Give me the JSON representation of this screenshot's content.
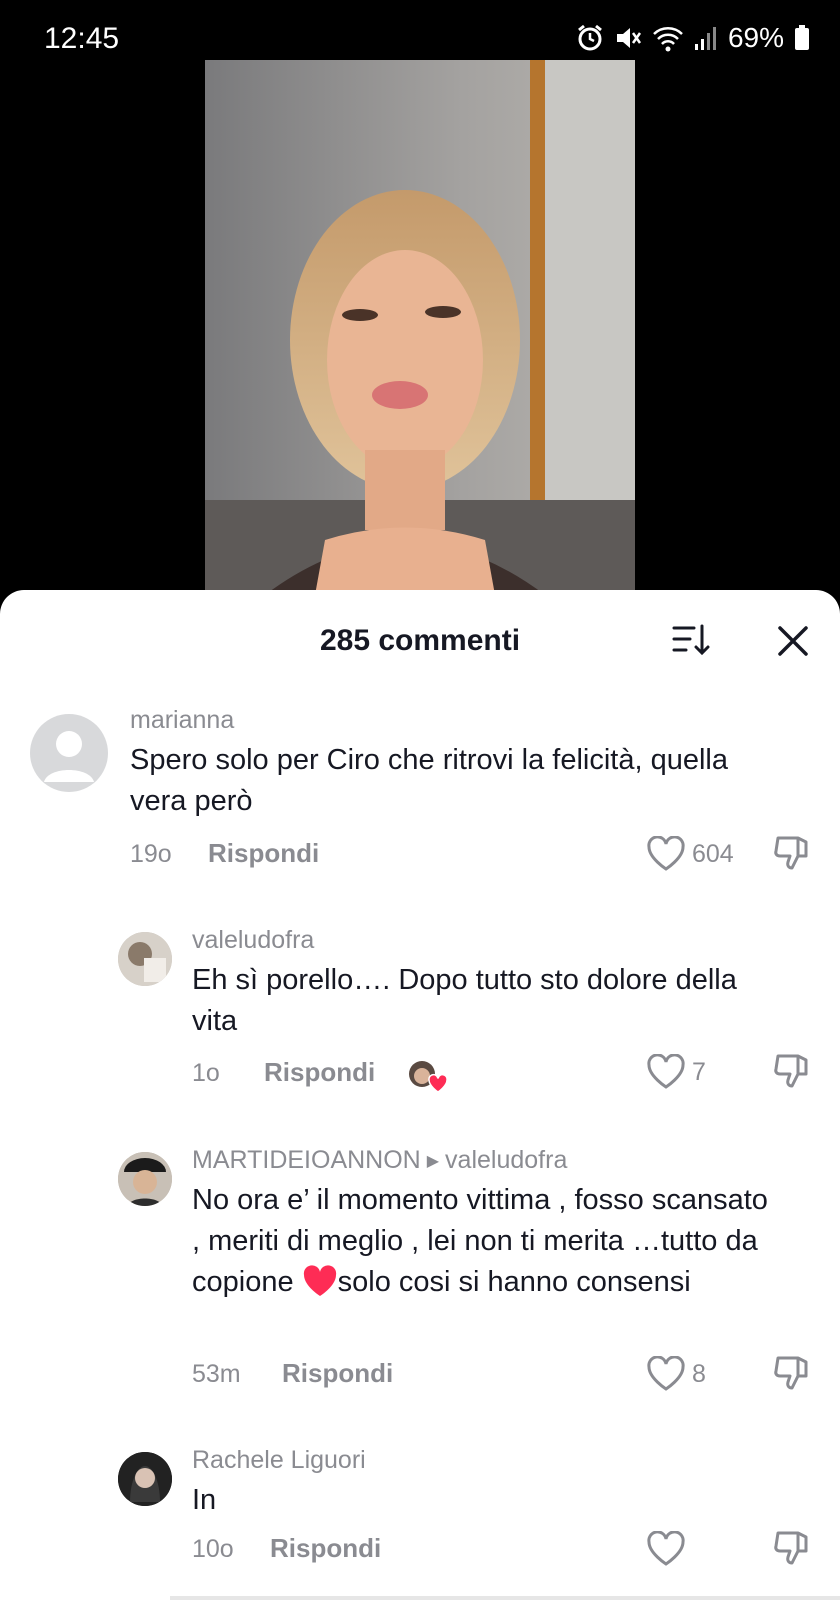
{
  "status": {
    "time": "12:45",
    "battery": "69%"
  },
  "sheet": {
    "title": "285 commenti"
  },
  "comments": [
    {
      "user": "marianna",
      "text": "Spero solo per Ciro che ritrovi la felicità, quella vera però",
      "time": "19o",
      "reply": "Rispondi",
      "likes": "604"
    },
    {
      "user": "valeludofra",
      "text": "Eh sì porello…. Dopo tutto sto dolore della vita",
      "time": "1o",
      "reply": "Rispondi",
      "likes": "7"
    },
    {
      "user": "MARTIDEIOANNON",
      "reply_to": "valeludofra",
      "text_a": "No ora e’ il momento vittima , fosso scansato , meriti di meglio , lei non ti merita …tutto da copione ",
      "text_b": "solo cosi si hanno consensi",
      "time": "53m",
      "reply": "Rispondi",
      "likes": "8"
    },
    {
      "user": "Rachele Liguori",
      "text": "In",
      "time": "10o",
      "reply": "Rispondi",
      "likes": ""
    }
  ],
  "icons": {
    "alarm": "alarm-icon",
    "mute": "mute-icon",
    "wifi": "wifi-icon",
    "signal": "signal-icon",
    "battery": "battery-icon",
    "sort": "sort-icon",
    "close": "close-icon",
    "like": "heart-outline-icon",
    "dislike": "thumbs-down-icon"
  },
  "colors": {
    "accent_heart": "#fe2c55",
    "muted_text": "#8a8b91",
    "primary_text": "#161823"
  }
}
